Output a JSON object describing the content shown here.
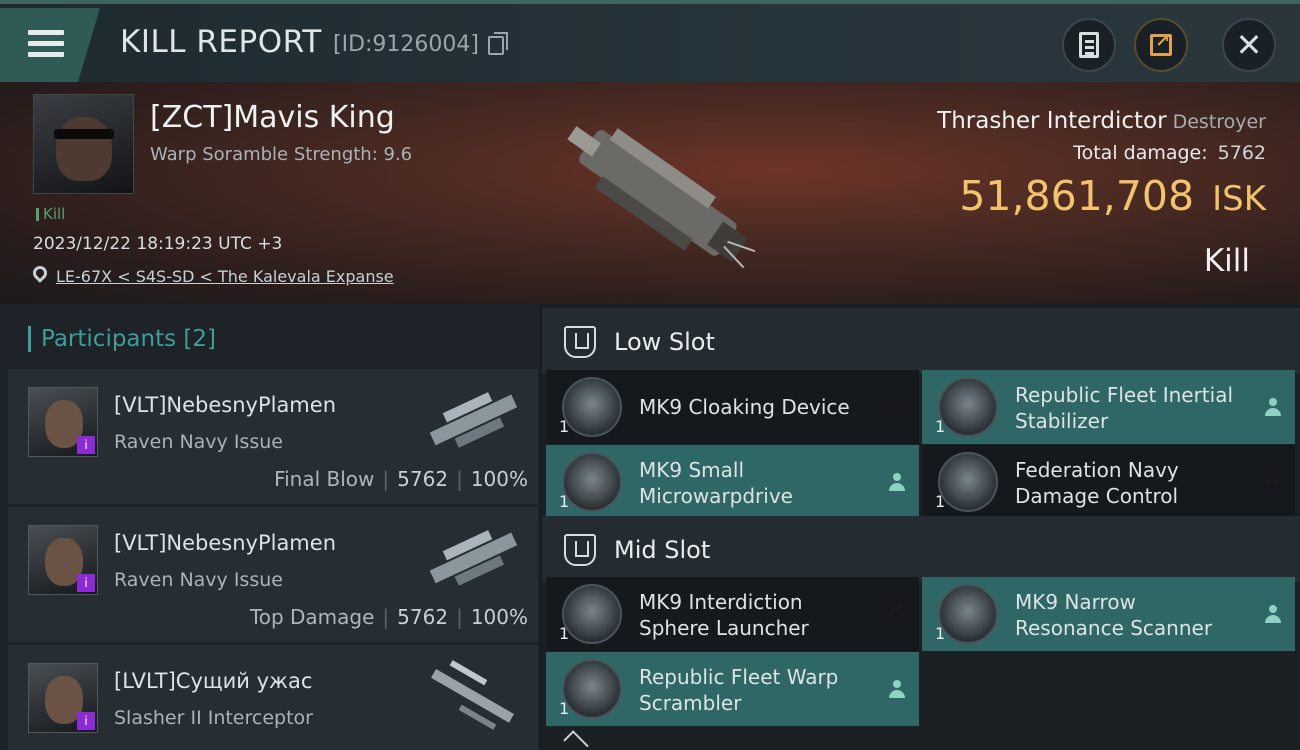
{
  "header": {
    "title": "KILL REPORT",
    "id_text": "[ID:9126004]",
    "icons": [
      "menu-icon",
      "copy-icon",
      "clipboard-icon",
      "share-icon",
      "close-icon"
    ],
    "close_glyph": "✕"
  },
  "victim": {
    "name": "[ZCT]Mavis King",
    "scramble": "Warp Soramble Strength: 9.6",
    "tag": "Kill",
    "datetime": "2023/12/22 18:19:23 UTC +3",
    "location": "LE-67X < S4S-SD < The Kalevala Expanse",
    "ship_name": "Thrasher Interdictor",
    "ship_class": "Destroyer",
    "total_damage_label": "Total damage:",
    "total_damage": "5762",
    "isk_value": "51,861,708",
    "isk_unit": "ISK",
    "result": "Kill"
  },
  "participants": {
    "label": "Participants",
    "count": "[2]",
    "items": [
      {
        "name": "[VLT]NebesnyPlamen",
        "ship": "Raven Navy Issue",
        "stat_label": "Final Blow",
        "damage": "5762",
        "percent": "100%",
        "badge": "i"
      },
      {
        "name": "[VLT]NebesnyPlamen",
        "ship": "Raven Navy Issue",
        "stat_label": "Top Damage",
        "damage": "5762",
        "percent": "100%",
        "badge": "i"
      },
      {
        "name": "[LVLT]Сущий ужас",
        "ship": "Slasher II Interceptor",
        "badge": "i"
      }
    ],
    "separator": "|"
  },
  "slots": {
    "low": {
      "label": "Low Slot",
      "modules": [
        {
          "name": "MK9 Cloaking Device",
          "qty": "1",
          "state": "destroyed"
        },
        {
          "name": "Republic Fleet Inertial Stabilizer",
          "qty": "1",
          "state": "dropped"
        },
        {
          "name": "MK9 Small Microwarpdrive",
          "qty": "1",
          "state": "dropped"
        },
        {
          "name": "Federation Navy Damage Control",
          "qty": "1",
          "state": "destroyed"
        }
      ]
    },
    "mid": {
      "label": "Mid Slot",
      "modules": [
        {
          "name": "MK9 Interdiction Sphere Launcher",
          "qty": "1",
          "state": "destroyed"
        },
        {
          "name": "MK9 Narrow Resonance Scanner",
          "qty": "1",
          "state": "dropped"
        },
        {
          "name": "Republic Fleet Warp Scrambler",
          "qty": "1",
          "state": "dropped"
        }
      ]
    },
    "x_glyph": "✕"
  },
  "colors": {
    "accent_teal": "#2f6766",
    "isk_gold": "#f0c36c",
    "kill_green": "#5a9f73",
    "badge_purple": "#8a2bd6"
  }
}
